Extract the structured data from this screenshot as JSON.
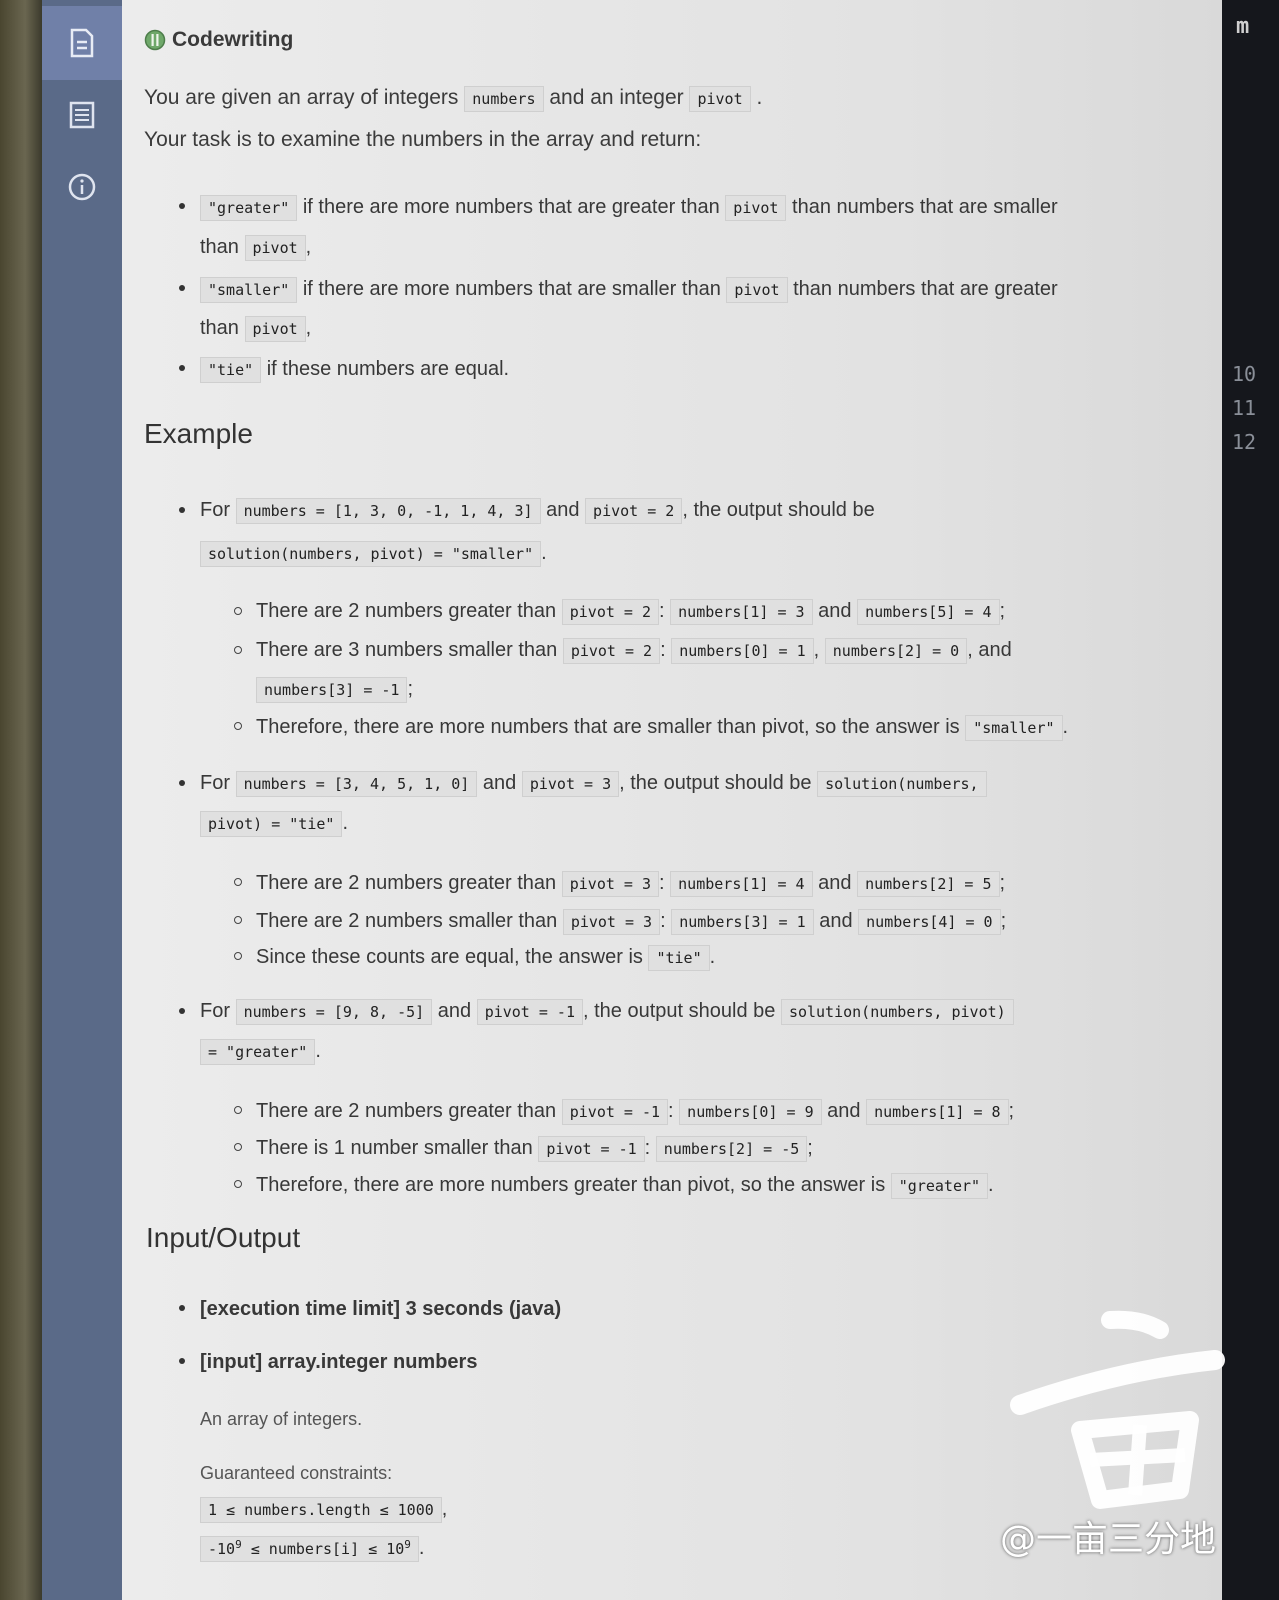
{
  "sidebar": {
    "items": [
      "description-icon",
      "list-icon",
      "info-icon"
    ]
  },
  "header": {
    "title": "Codewriting"
  },
  "intro": {
    "l1_a": "You are given an array of integers",
    "l1_code1": "numbers",
    "l1_b": "and an integer",
    "l1_code2": "pivot",
    "l1_c": ".",
    "l2": "Your task is to examine the numbers in the array and return:"
  },
  "returns": [
    {
      "code": "\"greater\"",
      "text1": "if there are more numbers that are greater than",
      "code2": "pivot",
      "text2": "than numbers that are smaller",
      "text3": "than",
      "code3": "pivot",
      "end": ","
    },
    {
      "code": "\"smaller\"",
      "text1": "if there are more numbers that are smaller than",
      "code2": "pivot",
      "text2": "than numbers that are greater",
      "text3": "than",
      "code3": "pivot",
      "end": ","
    },
    {
      "code": "\"tie\"",
      "text1": "if these numbers are equal."
    }
  ],
  "example": {
    "title": "Example",
    "for": "For",
    "and": "and",
    "ex1": {
      "numbers": "numbers = [1, 3, 0, -1, 1, 4, 3]",
      "pivot": "pivot = 2",
      "tail": ", the output should be",
      "result": "solution(numbers, pivot) = \"smaller\"",
      "s1_text": "There are 2 numbers greater than",
      "s1_c1": "pivot = 2",
      "s1_c2": "numbers[1] = 3",
      "s1_and": "and",
      "s1_c3": "numbers[5] = 4",
      "s2_text": "There are 3 numbers smaller than",
      "s2_c1": "pivot = 2",
      "s2_c2": "numbers[0] = 1",
      "s2_c3": "numbers[2] = 0",
      "s2_and": ", and",
      "s2_c4": "numbers[3] = -1",
      "s3_text": "Therefore, there are more numbers that are smaller than pivot, so the answer is",
      "s3_c": "\"smaller\""
    },
    "ex2": {
      "numbers": "numbers = [3, 4, 5, 1, 0]",
      "pivot": "pivot = 3",
      "tail": ", the output should be",
      "result1": "solution(numbers,",
      "result2": "pivot) = \"tie\"",
      "s1_text": "There are 2 numbers greater than",
      "s1_c1": "pivot = 3",
      "s1_c2": "numbers[1] = 4",
      "s1_and": "and",
      "s1_c3": "numbers[2] = 5",
      "s2_text": "There are 2 numbers smaller than",
      "s2_c1": "pivot = 3",
      "s2_c2": "numbers[3] = 1",
      "s2_and": "and",
      "s2_c3": "numbers[4] = 0",
      "s3_text": "Since these counts are equal, the answer is",
      "s3_c": "\"tie\""
    },
    "ex3": {
      "numbers": "numbers = [9, 8, -5]",
      "pivot": "pivot = -1",
      "tail": ", the output should be",
      "result1": "solution(numbers, pivot)",
      "result2": "= \"greater\"",
      "s1_text": "There are 2 numbers greater than",
      "s1_c1": "pivot = -1",
      "s1_c2": "numbers[0] = 9",
      "s1_and": "and",
      "s1_c3": "numbers[1] = 8",
      "s2_text": "There is 1 number smaller than",
      "s2_c1": "pivot = -1",
      "s2_c2": "numbers[2] = -5",
      "s3_text": "Therefore, there are more numbers greater than pivot, so the answer is",
      "s3_c": "\"greater\""
    }
  },
  "io": {
    "title": "Input/Output",
    "item1": "[execution time limit] 3 seconds (java)",
    "item2": "[input] array.integer numbers",
    "desc": "An array of integers.",
    "constraints_label": "Guaranteed constraints:",
    "c1": "1 ≤ numbers.length ≤ 1000",
    "c2_a": "-10",
    "c2_sup": "9",
    "c2_b": " ≤ numbers[i] ≤ 10",
    "c2_sup2": "9"
  },
  "right_panel": {
    "labels": [
      "m",
      "10",
      "11",
      "12"
    ]
  },
  "watermark": {
    "text": "@一亩三分地"
  }
}
